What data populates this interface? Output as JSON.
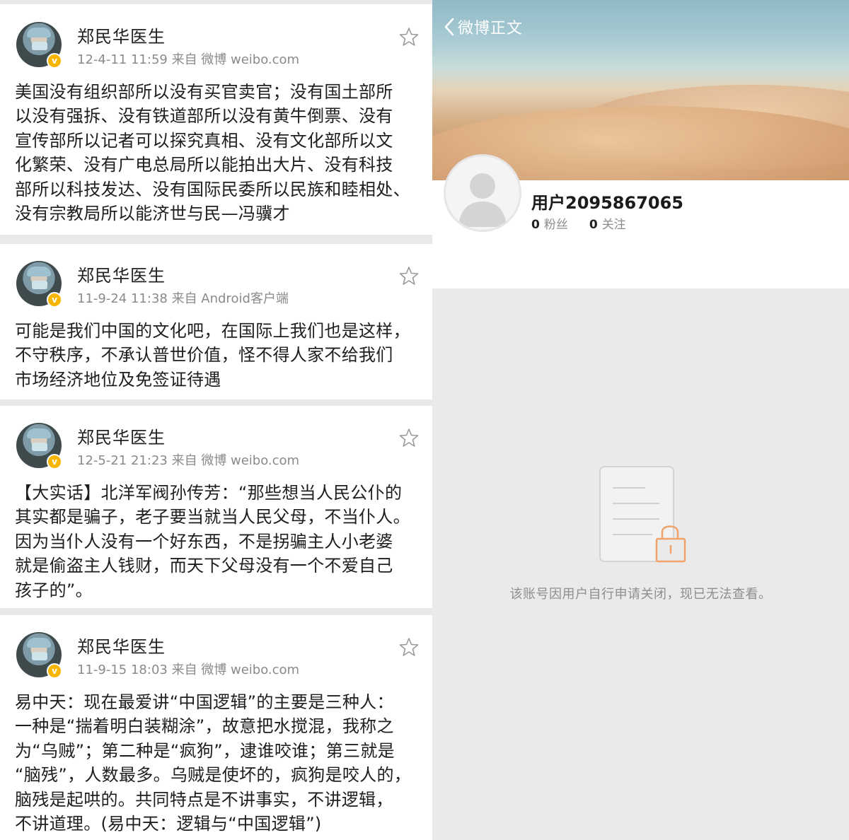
{
  "posts": [
    {
      "author": "郑民华医生",
      "verified_badge": "v",
      "meta": "12-4-11 11:59  来自 微博 weibo.com",
      "lines": [
        "美国没有组织部所以没有买官卖官；没有国土部所",
        "以没有强拆、没有铁道部所以没有黄牛倒票、没有",
        "宣传部所以记者可以探究真相、没有文化部所以文",
        "化繁荣、没有广电总局所以能拍出大片、没有科技",
        "部所以科技发达、没有国际民委所以民族和睦相处、",
        "没有宗教局所以能济世与民—冯骥才"
      ]
    },
    {
      "author": "郑民华医生",
      "verified_badge": "v",
      "meta": "11-9-24 11:38  来自 Android客户端",
      "lines": [
        "可能是我们中国的文化吧，在国际上我们也是这样，",
        "不守秩序，不承认普世价值，怪不得人家不给我们",
        "市场经济地位及免签证待遇"
      ]
    },
    {
      "author": "郑民华医生",
      "verified_badge": "v",
      "meta": "12-5-21 21:23  来自 微博 weibo.com",
      "lines": [
        "【大实话】北洋军阀孙传芳：“那些想当人民公仆的",
        "其实都是骗子，老子要当就当人民父母，不当仆人。",
        "因为当仆人没有一个好东西，不是拐骗主人小老婆",
        "就是偷盗主人钱财，而天下父母没有一个不爱自己",
        "孩子的”。"
      ]
    },
    {
      "author": "郑民华医生",
      "verified_badge": "v",
      "meta": "11-9-15 18:03  来自 微博 weibo.com",
      "lines": [
        "易中天：现在最爱讲“中国逻辑”的主要是三种人：",
        "一种是“揣着明白装糊涂”，故意把水搅混，我称之",
        "为“乌贼”；第二种是“疯狗”，逮谁咬谁；第三就是",
        "“脑残”，人数最多。乌贼是使坏的，疯狗是咬人的，",
        "脑残是起哄的。共同特点是不讲事实，不讲逻辑，",
        "不讲道理。(易中天：逻辑与“中国逻辑”)"
      ]
    }
  ],
  "profile": {
    "back_label": "微博正文",
    "username": "用户2095867065",
    "followers_count": "0",
    "followers_label": "粉丝",
    "following_count": "0",
    "following_label": "关注",
    "closed_message": "该账号因用户自行申请关闭，现已无法查看。"
  },
  "colors": {
    "accent_orange": "#f0a36a",
    "verified_yellow": "#f7b500",
    "meta_gray": "#8a8a8a"
  },
  "icons": [
    "star-icon",
    "back-chevron-icon",
    "default-avatar-icon",
    "document-lock-icon",
    "verified-badge-icon"
  ]
}
